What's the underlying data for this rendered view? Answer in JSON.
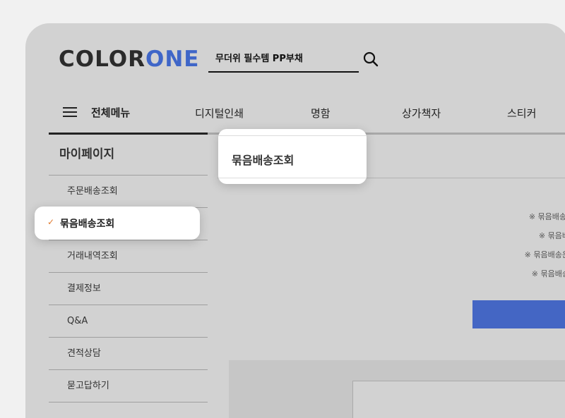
{
  "header": {
    "logo_dark": "COLOR",
    "logo_blue": "ONE",
    "search_value": "무더위 필수템 PP부채"
  },
  "gnb": {
    "all_menu": "전체메뉴",
    "items": [
      "디지털인쇄",
      "명함",
      "상가책자",
      "스티커"
    ]
  },
  "lnb": {
    "title": "마이페이지",
    "items": [
      "주문배송조회",
      "묶음배송조회",
      "거래내역조회",
      "결제정보",
      "Q&A",
      "견적상담",
      "묻고답하기"
    ],
    "active_index": 1
  },
  "content": {
    "title": "묶음배송조회",
    "notices": [
      "※ 묶음배송-",
      "※ 묶음배",
      "※ 묶음배송은",
      "※ 묶음배송"
    ]
  },
  "colors": {
    "accent": "#4466c4",
    "check": "#e07a2e"
  }
}
